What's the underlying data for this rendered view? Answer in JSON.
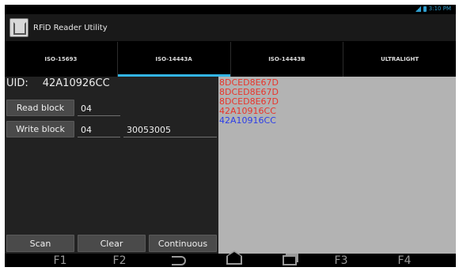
{
  "status": {
    "time": "3:10 PM"
  },
  "app": {
    "title": "RFiD Reader Utility"
  },
  "tabs": [
    {
      "label": "ISO-15693",
      "active": false
    },
    {
      "label": "ISO-14443A",
      "active": true
    },
    {
      "label": "ISO-14443B",
      "active": false
    },
    {
      "label": "ULTRALIGHT",
      "active": false
    }
  ],
  "uid": {
    "label": "UID:",
    "value": "42A10926CC"
  },
  "read": {
    "button": "Read block",
    "block": "04"
  },
  "write": {
    "button": "Write block",
    "block": "04",
    "data": "30053005"
  },
  "log": [
    {
      "text": "8DCED8E67D",
      "color": "#e8352b"
    },
    {
      "text": "8DCED8E67D",
      "color": "#e8352b"
    },
    {
      "text": "8DCED8E67D",
      "color": "#e8352b"
    },
    {
      "text": "42A10916CC",
      "color": "#e8352b"
    },
    {
      "text": "42A10916CC",
      "color": "#2b3de8"
    }
  ],
  "actions": {
    "scan": "Scan",
    "clear": "Clear",
    "continuous": "Continuous"
  },
  "nav": {
    "f1": "F1",
    "f2": "F2",
    "f3": "F3",
    "f4": "F4"
  },
  "colors": {
    "accent": "#33b5e5",
    "log_red": "#e8352b",
    "log_blue": "#2b3de8"
  }
}
